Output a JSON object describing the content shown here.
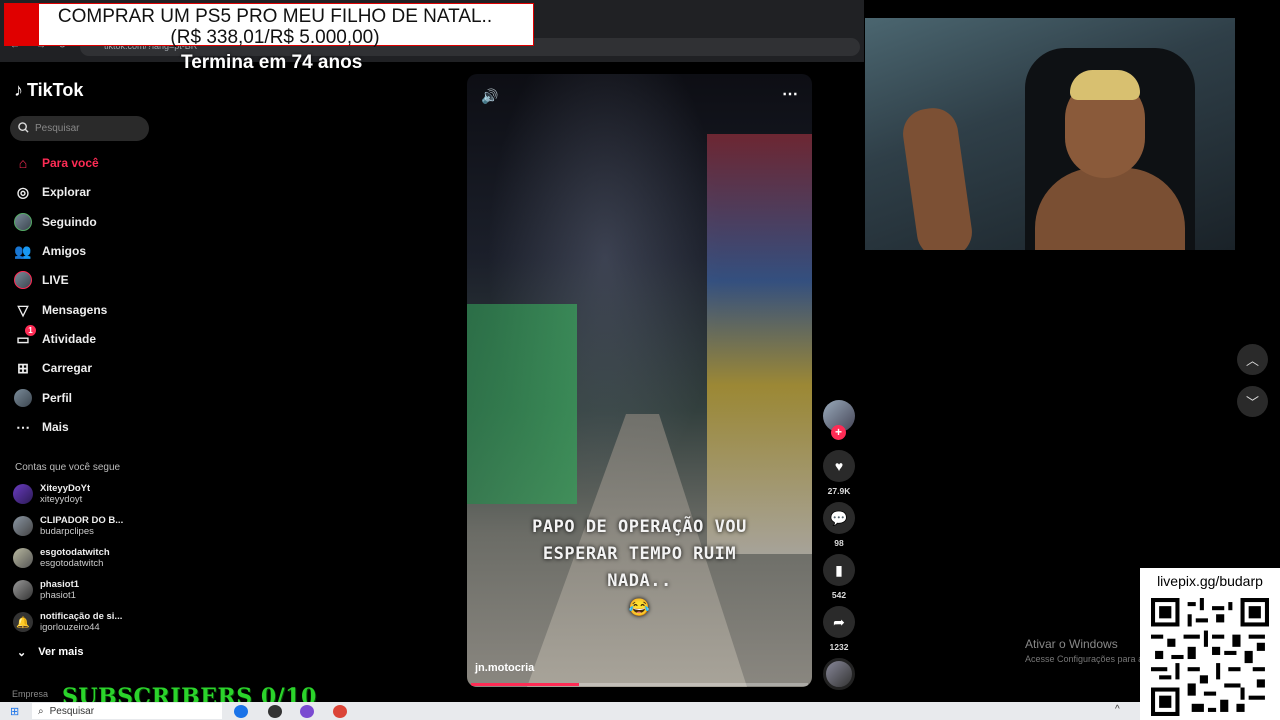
{
  "browser": {
    "url": "tiktok.com/?lang=pt-BR"
  },
  "stream_overlay": {
    "goal_line1": "COMPRAR UM PS5 PRO MEU FILHO DE NATAL..",
    "goal_line2": "(R$ 338,01/R$ 5.000,00)",
    "goal_countdown": "Termina em 74 anos",
    "subscribers": "SUBSCRIBERS 0/10",
    "pix_url": "livepix.gg/budarp"
  },
  "sidebar": {
    "logo": "TikTok",
    "search_placeholder": "Pesquisar",
    "nav": [
      {
        "label": "Para você",
        "icon": "home-icon"
      },
      {
        "label": "Explorar",
        "icon": "compass-icon"
      },
      {
        "label": "Seguindo",
        "icon": "avatar-icon"
      },
      {
        "label": "Amigos",
        "icon": "friends-icon"
      },
      {
        "label": "LIVE",
        "icon": "live-avatar-icon"
      },
      {
        "label": "Mensagens",
        "icon": "send-icon"
      },
      {
        "label": "Atividade",
        "icon": "activity-icon",
        "badge": "1"
      },
      {
        "label": "Carregar",
        "icon": "upload-icon"
      },
      {
        "label": "Perfil",
        "icon": "profile-icon"
      },
      {
        "label": "Mais",
        "icon": "more-icon"
      }
    ],
    "following_heading": "Contas que você segue",
    "following": [
      {
        "name": "XiteyyDoYt",
        "handle": "xiteyydoyt"
      },
      {
        "name": "CLIPADOR DO B...",
        "handle": "budarpclipes"
      },
      {
        "name": "esgotodatwitch",
        "handle": "esgotodatwitch"
      },
      {
        "name": "phasiot1",
        "handle": "phasiot1"
      },
      {
        "name": "notificação de si...",
        "handle": "igorlouzeiro44"
      }
    ],
    "see_more": "Ver mais",
    "footer": "Empresa"
  },
  "video": {
    "caption_lines": [
      "PAPO DE OPERAÇÃO VOU",
      "ESPERAR TEMPO RUIM",
      "NADA..",
      "😂"
    ],
    "author": "jn.motocria",
    "progress": 0.32
  },
  "actions": {
    "likes": "27.9K",
    "comments": "98",
    "saves": "542",
    "shares": "1232"
  },
  "windows": {
    "activate_title": "Ativar o Windows",
    "activate_sub": "Acesse Configurações para ativar o Windows.",
    "taskbar_search": "Pesquisar"
  },
  "colors": {
    "accent": "#fe2c55",
    "subs_green": "#2bd42b"
  }
}
